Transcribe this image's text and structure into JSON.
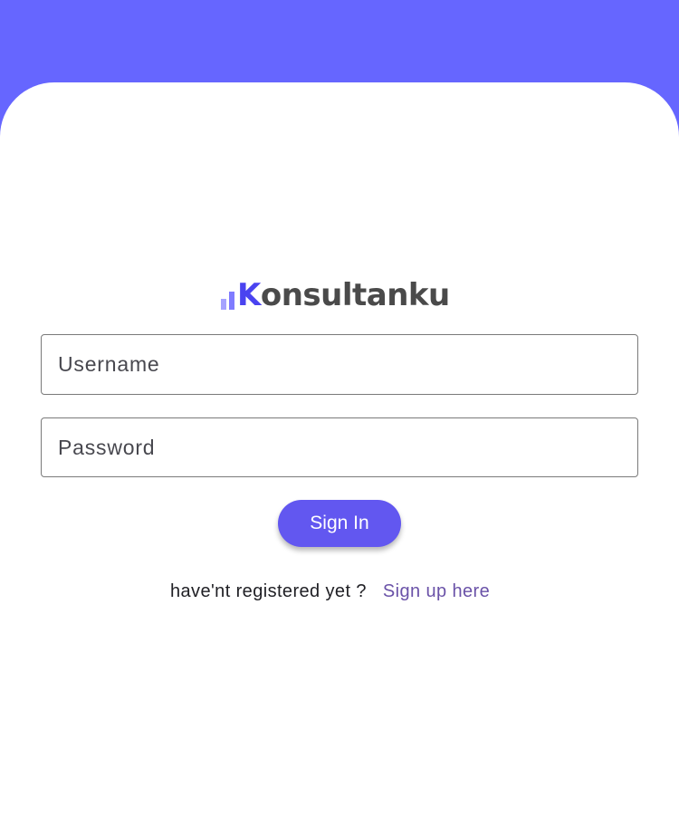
{
  "brand": {
    "logo_k": "K",
    "logo_rest": "onsultanku",
    "colors": {
      "header_bg": "#6666ff",
      "logo_k": "#4a43f0",
      "logo_text": "#4a4a4a",
      "bar_light": "#a6a3ff",
      "bar_mid": "#7f7bff"
    },
    "icon": "signal-bars-icon"
  },
  "form": {
    "username_placeholder": "Username",
    "username_value": "",
    "password_placeholder": "Password",
    "password_value": "",
    "signin_label": "Sign In",
    "signin_color": "#6257f0"
  },
  "footer": {
    "prompt": "have'nt registered yet ?",
    "signup_label": "Sign up here",
    "link_color": "#6a52a8"
  }
}
